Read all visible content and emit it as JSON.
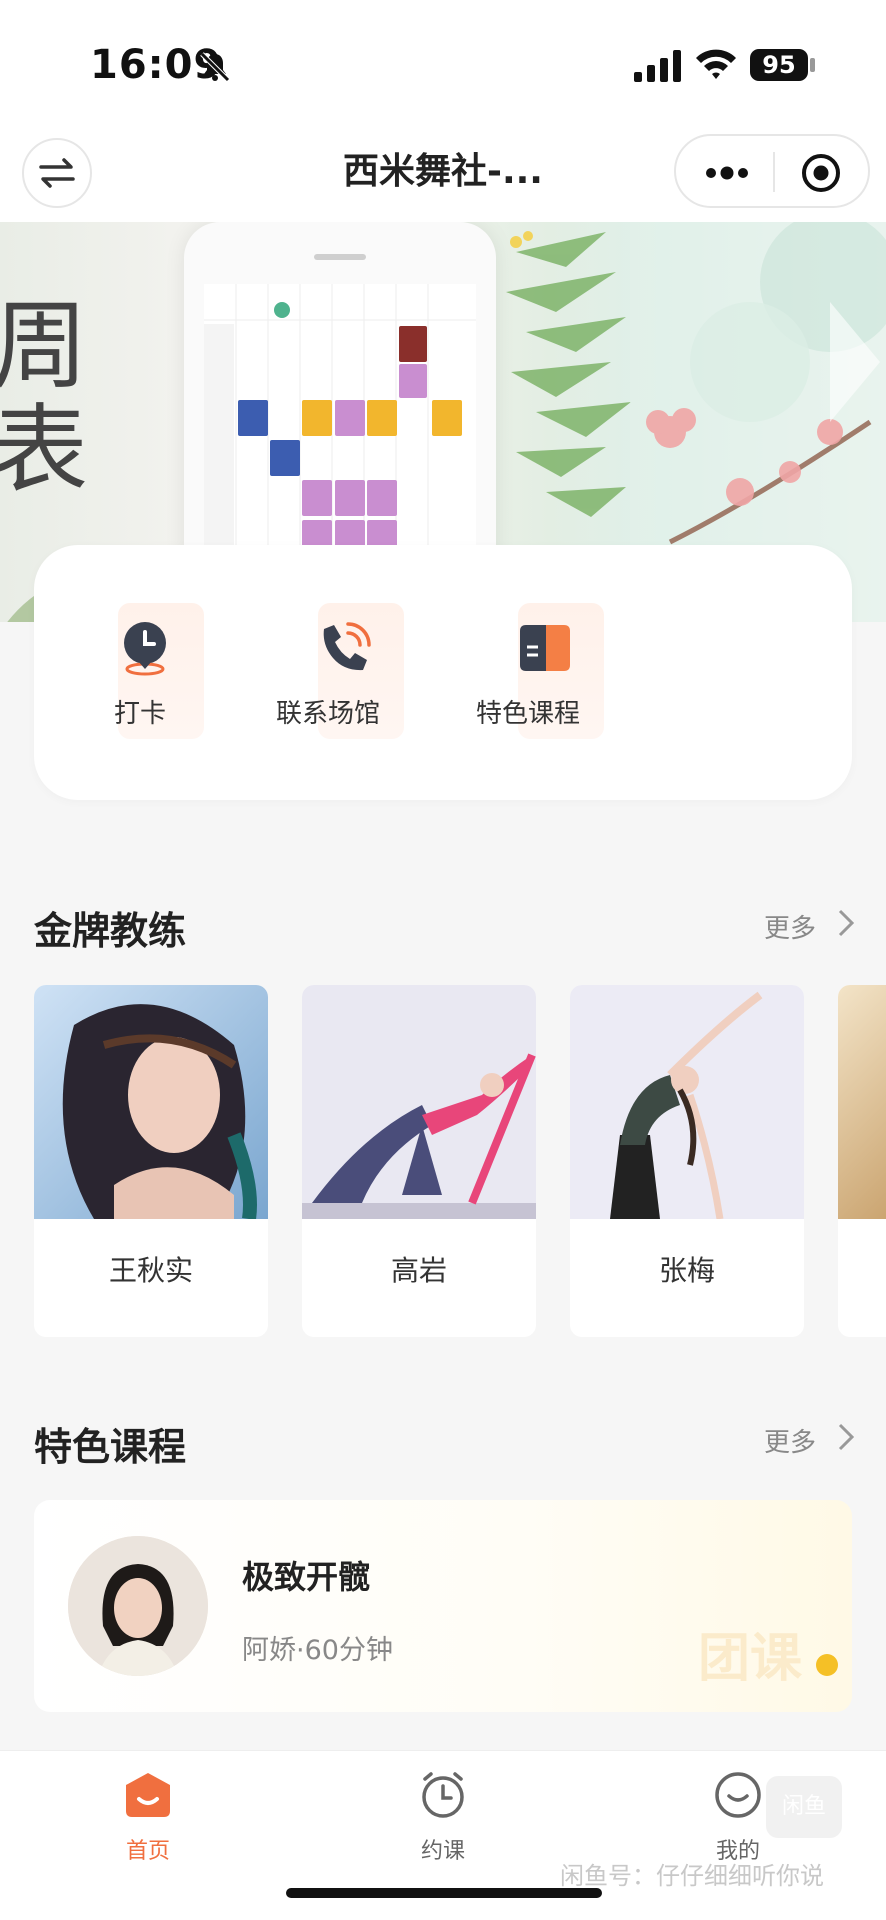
{
  "status_bar": {
    "time": "16:09",
    "battery": "95"
  },
  "nav": {
    "title": "西米舞社-..."
  },
  "banner": {
    "chars": [
      "周",
      "表"
    ]
  },
  "quick_actions": [
    {
      "label": "打卡",
      "icon": "clock-pin-icon"
    },
    {
      "label": "联系场馆",
      "icon": "phone-call-icon"
    },
    {
      "label": "特色课程",
      "icon": "book-icon"
    }
  ],
  "coaches_section": {
    "title": "金牌教练",
    "more": "更多",
    "coaches": [
      {
        "name": "王秋实"
      },
      {
        "name": "高岩"
      },
      {
        "name": "张梅"
      }
    ]
  },
  "courses_section": {
    "title": "特色课程",
    "more": "更多",
    "course": {
      "title": "极致开髋",
      "meta": "阿娇·60分钟",
      "tag": "团课"
    }
  },
  "tabbar": {
    "items": [
      {
        "label": "首页",
        "icon": "home-icon",
        "active": true
      },
      {
        "label": "约课",
        "icon": "alarm-clock-icon",
        "active": false
      },
      {
        "label": "我的",
        "icon": "smile-face-icon",
        "active": false
      }
    ]
  },
  "watermark": {
    "text": "闲鱼号：仔仔细细听你说",
    "badge": "闲鱼"
  },
  "colors": {
    "accent": "#f06f3f",
    "badge_dot": "#f5c026",
    "icon_dark": "#3a4150"
  }
}
